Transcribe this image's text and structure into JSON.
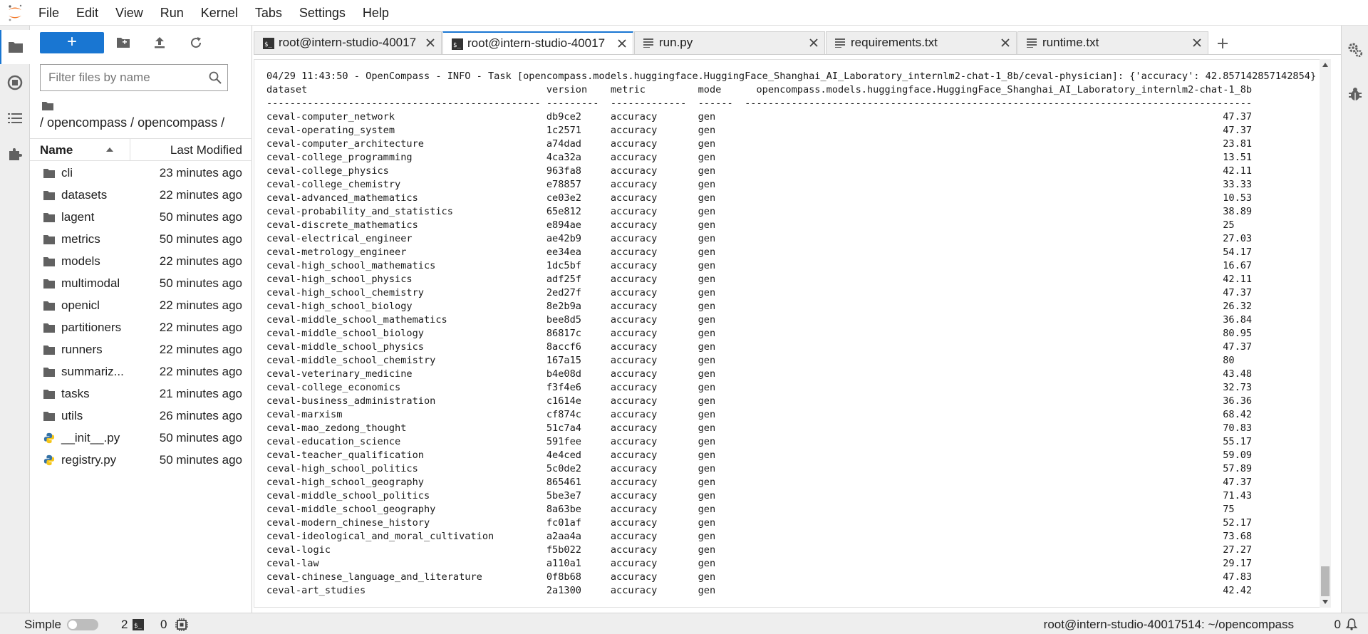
{
  "menu": [
    "File",
    "Edit",
    "View",
    "Run",
    "Kernel",
    "Tabs",
    "Settings",
    "Help"
  ],
  "filebrowser": {
    "new_button_label": "+",
    "filter_placeholder": "Filter files by name",
    "breadcrumb": "/ opencompass / opencompass /",
    "col_name": "Name",
    "col_modified": "Last Modified",
    "items": [
      {
        "name": "cli",
        "type": "folder",
        "modified": "23 minutes ago"
      },
      {
        "name": "datasets",
        "type": "folder",
        "modified": "22 minutes ago"
      },
      {
        "name": "lagent",
        "type": "folder",
        "modified": "50 minutes ago"
      },
      {
        "name": "metrics",
        "type": "folder",
        "modified": "50 minutes ago"
      },
      {
        "name": "models",
        "type": "folder",
        "modified": "22 minutes ago"
      },
      {
        "name": "multimodal",
        "type": "folder",
        "modified": "50 minutes ago"
      },
      {
        "name": "openicl",
        "type": "folder",
        "modified": "22 minutes ago"
      },
      {
        "name": "partitioners",
        "type": "folder",
        "modified": "22 minutes ago"
      },
      {
        "name": "runners",
        "type": "folder",
        "modified": "22 minutes ago"
      },
      {
        "name": "summariz...",
        "type": "folder",
        "modified": "22 minutes ago"
      },
      {
        "name": "tasks",
        "type": "folder",
        "modified": "21 minutes ago"
      },
      {
        "name": "utils",
        "type": "folder",
        "modified": "26 minutes ago"
      },
      {
        "name": "__init__.py",
        "type": "python",
        "modified": "50 minutes ago"
      },
      {
        "name": "registry.py",
        "type": "python",
        "modified": "50 minutes ago"
      }
    ]
  },
  "tabs": [
    {
      "label": "root@intern-studio-40017",
      "icon": "terminal-icon",
      "active": false
    },
    {
      "label": "root@intern-studio-40017",
      "icon": "terminal-icon",
      "active": true
    },
    {
      "label": "run.py",
      "icon": "python-file-icon",
      "active": false
    },
    {
      "label": "requirements.txt",
      "icon": "text-file-icon",
      "active": false
    },
    {
      "label": "runtime.txt",
      "icon": "text-file-icon",
      "active": false
    }
  ],
  "terminal": {
    "log_line": "04/29 11:43:50 - OpenCompass - INFO - Task [opencompass.models.huggingface.HuggingFace_Shanghai_AI_Laboratory_internlm2-chat-1_8b/ceval-physician]: {'accuracy': 42.857142857142854}",
    "headers": [
      "dataset",
      "version",
      "metric",
      "mode",
      "opencompass.models.huggingface.HuggingFace_Shanghai_AI_Laboratory_internlm2-chat-1_8b"
    ],
    "rows": [
      [
        "ceval-computer_network",
        "db9ce2",
        "accuracy",
        "gen",
        "47.37"
      ],
      [
        "ceval-operating_system",
        "1c2571",
        "accuracy",
        "gen",
        "47.37"
      ],
      [
        "ceval-computer_architecture",
        "a74dad",
        "accuracy",
        "gen",
        "23.81"
      ],
      [
        "ceval-college_programming",
        "4ca32a",
        "accuracy",
        "gen",
        "13.51"
      ],
      [
        "ceval-college_physics",
        "963fa8",
        "accuracy",
        "gen",
        "42.11"
      ],
      [
        "ceval-college_chemistry",
        "e78857",
        "accuracy",
        "gen",
        "33.33"
      ],
      [
        "ceval-advanced_mathematics",
        "ce03e2",
        "accuracy",
        "gen",
        "10.53"
      ],
      [
        "ceval-probability_and_statistics",
        "65e812",
        "accuracy",
        "gen",
        "38.89"
      ],
      [
        "ceval-discrete_mathematics",
        "e894ae",
        "accuracy",
        "gen",
        "25"
      ],
      [
        "ceval-electrical_engineer",
        "ae42b9",
        "accuracy",
        "gen",
        "27.03"
      ],
      [
        "ceval-metrology_engineer",
        "ee34ea",
        "accuracy",
        "gen",
        "54.17"
      ],
      [
        "ceval-high_school_mathematics",
        "1dc5bf",
        "accuracy",
        "gen",
        "16.67"
      ],
      [
        "ceval-high_school_physics",
        "adf25f",
        "accuracy",
        "gen",
        "42.11"
      ],
      [
        "ceval-high_school_chemistry",
        "2ed27f",
        "accuracy",
        "gen",
        "47.37"
      ],
      [
        "ceval-high_school_biology",
        "8e2b9a",
        "accuracy",
        "gen",
        "26.32"
      ],
      [
        "ceval-middle_school_mathematics",
        "bee8d5",
        "accuracy",
        "gen",
        "36.84"
      ],
      [
        "ceval-middle_school_biology",
        "86817c",
        "accuracy",
        "gen",
        "80.95"
      ],
      [
        "ceval-middle_school_physics",
        "8accf6",
        "accuracy",
        "gen",
        "47.37"
      ],
      [
        "ceval-middle_school_chemistry",
        "167a15",
        "accuracy",
        "gen",
        "80"
      ],
      [
        "ceval-veterinary_medicine",
        "b4e08d",
        "accuracy",
        "gen",
        "43.48"
      ],
      [
        "ceval-college_economics",
        "f3f4e6",
        "accuracy",
        "gen",
        "32.73"
      ],
      [
        "ceval-business_administration",
        "c1614e",
        "accuracy",
        "gen",
        "36.36"
      ],
      [
        "ceval-marxism",
        "cf874c",
        "accuracy",
        "gen",
        "68.42"
      ],
      [
        "ceval-mao_zedong_thought",
        "51c7a4",
        "accuracy",
        "gen",
        "70.83"
      ],
      [
        "ceval-education_science",
        "591fee",
        "accuracy",
        "gen",
        "55.17"
      ],
      [
        "ceval-teacher_qualification",
        "4e4ced",
        "accuracy",
        "gen",
        "59.09"
      ],
      [
        "ceval-high_school_politics",
        "5c0de2",
        "accuracy",
        "gen",
        "57.89"
      ],
      [
        "ceval-high_school_geography",
        "865461",
        "accuracy",
        "gen",
        "47.37"
      ],
      [
        "ceval-middle_school_politics",
        "5be3e7",
        "accuracy",
        "gen",
        "71.43"
      ],
      [
        "ceval-middle_school_geography",
        "8a63be",
        "accuracy",
        "gen",
        "75"
      ],
      [
        "ceval-modern_chinese_history",
        "fc01af",
        "accuracy",
        "gen",
        "52.17"
      ],
      [
        "ceval-ideological_and_moral_cultivation",
        "a2aa4a",
        "accuracy",
        "gen",
        "73.68"
      ],
      [
        "ceval-logic",
        "f5b022",
        "accuracy",
        "gen",
        "27.27"
      ],
      [
        "ceval-law",
        "a110a1",
        "accuracy",
        "gen",
        "29.17"
      ],
      [
        "ceval-chinese_language_and_literature",
        "0f8b68",
        "accuracy",
        "gen",
        "47.83"
      ],
      [
        "ceval-art_studies",
        "2a1300",
        "accuracy",
        "gen",
        "42.42"
      ]
    ]
  },
  "statusbar": {
    "mode_label": "Simple",
    "terminals_count": "2",
    "kernels_count": "0",
    "path": "root@intern-studio-40017514: ~/opencompass",
    "notifications_count": "0"
  },
  "colors": {
    "accent": "#1976d2",
    "python_icon": "#3572a5",
    "folder_icon": "#616161",
    "logo": "#f37726"
  }
}
